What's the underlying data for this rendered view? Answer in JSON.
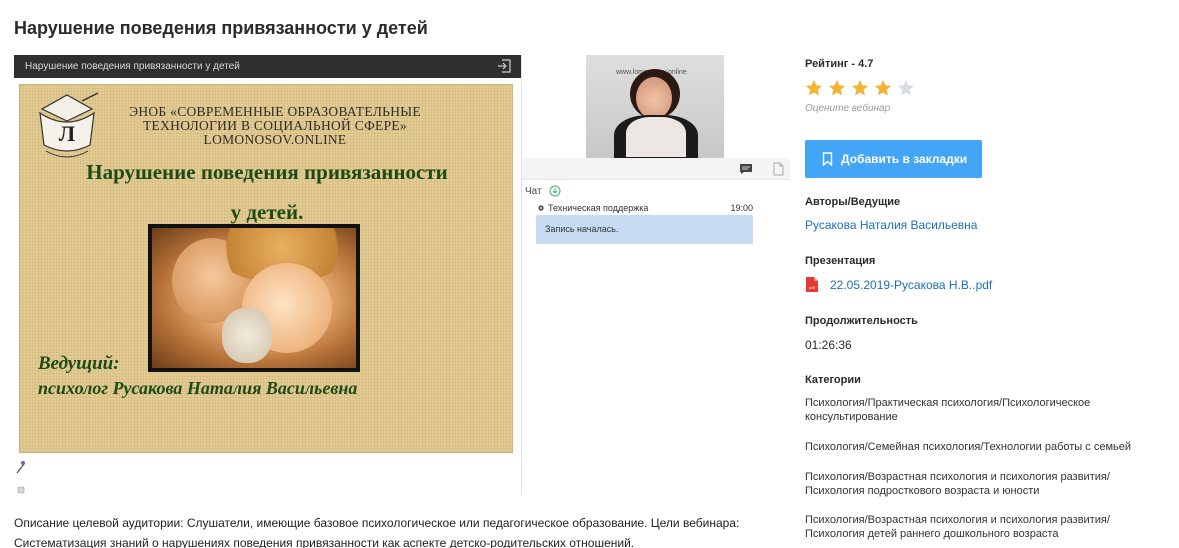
{
  "page": {
    "title": "Нарушение поведения привязанности у детей"
  },
  "player": {
    "bar_title": "Нарушение поведения привязанности у детей",
    "slide": {
      "org_line1": "ЭНОБ «СОВРЕМЕННЫЕ ОБРАЗОВАТЕЛЬНЫЕ",
      "org_line2": "ТЕХНОЛОГИИ В СОЦИАЛЬНОЙ СФЕРЕ»",
      "org_line3": "LOMONOSOV.ONLINE",
      "title_line1": "Нарушение поведения привязанности",
      "title_line2": "у детей.",
      "host_line1": "Ведущий:",
      "host_line2": "психолог Русакова Наталия Васильевна"
    }
  },
  "video": {
    "wall_text": "www.lomonosov.online"
  },
  "chat": {
    "label": "Чат",
    "messages": [
      {
        "author": "Техническая поддержка",
        "time": "19:00",
        "text": "Запись началась."
      }
    ]
  },
  "sidebar": {
    "rating_label": "Рейтинг - 4.7",
    "rating_value": 4.7,
    "stars_filled": 4,
    "stars_total": 5,
    "rate_hint": "Оцените вебинар",
    "bookmark_label": "Добавить в закладки",
    "authors_label": "Авторы/Ведущие",
    "author_name": "Русакова Наталия Васильевна",
    "presentation_label": "Презентация",
    "presentation_file": "22.05.2019-Русакова Н.В..pdf",
    "duration_label": "Продолжительность",
    "duration_value": "01:26:36",
    "categories_label": "Категории",
    "categories": [
      "Психология/Практическая психология/Психологическое консультирование",
      "Психология/Семейная психология/Технологии работы с семьей",
      "Психология/Возрастная психология и психология развития/Психология подросткового возраста и юности",
      "Психология/Возрастная психология и психология развития/Психология детей раннего дошкольного возраста"
    ]
  },
  "description": {
    "line1": "Описание целевой аудитории: Слушатели, имеющие базовое психологическое или педагогическое образование. Цели вебинара:",
    "line2": "Систематизация знаний о нарушениях поведения привязанности как аспекте детско-родительских отношений."
  },
  "colors": {
    "accent": "#42a5f5",
    "link": "#1f6fb8",
    "star_filled": "#f5b335",
    "star_empty": "#d7dde3",
    "chat_bubble": "#c7dcf2",
    "player_bar": "#2f2f2f",
    "slide_text": "#1d4a14"
  },
  "icons": [
    "exit-icon",
    "chat-icon",
    "document-icon",
    "download-icon",
    "gear-icon",
    "star-icon",
    "bookmark-icon",
    "pdf-icon",
    "pencil-icon",
    "eraser-icon"
  ]
}
